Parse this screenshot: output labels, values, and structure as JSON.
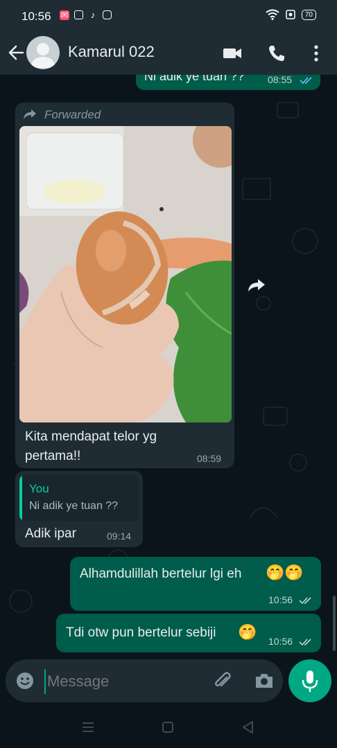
{
  "status_bar": {
    "time": "10:56",
    "battery": "70",
    "app_icons": [
      "notification-icon",
      "shop-icon",
      "tiktok-icon",
      "instagram-icon"
    ]
  },
  "header": {
    "contact_name": "Kamarul 022"
  },
  "messages": {
    "m0": {
      "text": "Ni adik ye tuan ??",
      "time": "08:55",
      "ticks": "read"
    },
    "m1": {
      "forwarded": "Forwarded",
      "caption_line1": "Kita mendapat telor yg",
      "caption_line2": "pertama!!",
      "time": "08:59"
    },
    "m2": {
      "quote_author": "You",
      "quote_text": "Ni adik ye tuan ??",
      "text": "Adik ipar",
      "time": "09:14"
    },
    "m3": {
      "text": "Alhamdulillah bertelur lgi eh",
      "emoji": "🤭🤭",
      "time": "10:56",
      "ticks": "delivered"
    },
    "m4": {
      "text": "Tdi otw pun bertelur sebiji",
      "emoji": "🤭",
      "time": "10:56",
      "ticks": "delivered"
    }
  },
  "composer": {
    "placeholder": "Message"
  },
  "colors": {
    "header_bg": "#1f2c34",
    "incoming_bg": "#1f2c34",
    "outgoing_bg": "#005c4b",
    "accent": "#00a884",
    "quote_accent": "#06cf9c",
    "read_tick": "#53bdeb"
  }
}
